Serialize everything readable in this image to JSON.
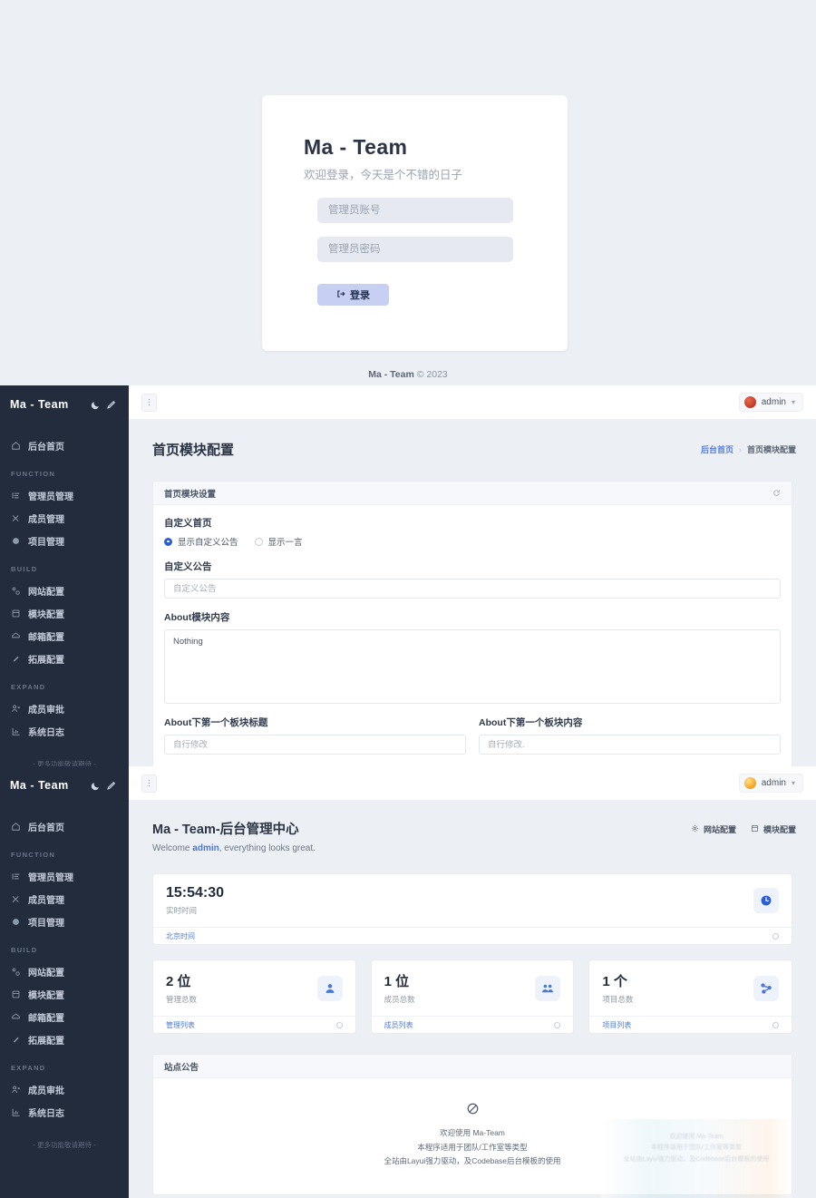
{
  "login": {
    "title": "Ma - Team",
    "subtitle": "欢迎登录，今天是个不错的日子",
    "username_placeholder": "管理员账号",
    "username_value": "",
    "password_placeholder": "管理员密码",
    "password_value": "",
    "submit_label": "登录",
    "footer": "Ma - Team © 2023",
    "footer_brand": "Ma - Team",
    "footer_rest": " © 2023",
    "button_color": "#c7d0f2",
    "background": "#eceff4"
  },
  "sidebar": {
    "logo": "Ma - Team",
    "theme_icon": "moon-icon",
    "edit_icon": "pen-icon",
    "footer_note": "- 更多功能敬请期待 -",
    "groups": [
      {
        "label": "",
        "items": [
          {
            "label": "后台首页",
            "icon": "home-icon"
          }
        ]
      },
      {
        "label": "FUNCTION",
        "items": [
          {
            "label": "管理员管理",
            "icon": "list-icon"
          },
          {
            "label": "成员管理",
            "icon": "shuffle-icon"
          },
          {
            "label": "项目管理",
            "icon": "box-icon"
          }
        ]
      },
      {
        "label": "BUILD",
        "items": [
          {
            "label": "网站配置",
            "icon": "settings-icon"
          },
          {
            "label": "模块配置",
            "icon": "module-icon"
          },
          {
            "label": "邮箱配置",
            "icon": "mail-icon"
          },
          {
            "label": "拓展配置",
            "icon": "plugin-icon"
          }
        ]
      },
      {
        "label": "EXPAND",
        "items": [
          {
            "label": "成员审批",
            "icon": "user-check-icon"
          },
          {
            "label": "系统日志",
            "icon": "chart-icon"
          }
        ]
      }
    ]
  },
  "panel_one": {
    "topbar": {
      "menu_icon": "dots-vertical-icon",
      "user": "admin",
      "avatar": "red-avatar",
      "chevron": "chevron-down-icon"
    },
    "page_title": "首页模块配置",
    "breadcrumb": {
      "home": "后台首页",
      "sep": "›",
      "current": "首页模块配置"
    },
    "card": {
      "title": "首页模块设置",
      "refresh_icon": "refresh-icon",
      "section_label": "自定义首页",
      "radios": [
        {
          "label": "显示自定义公告",
          "selected": true
        },
        {
          "label": "显示一言",
          "selected": false
        }
      ],
      "notice_label": "自定义公告",
      "notice_placeholder": "自定义公告",
      "notice_value": "",
      "about_label": "About模块内容",
      "about_value": "Nothing",
      "sub_title_label": "About下第一个板块标题",
      "sub_title_placeholder": "自行修改",
      "sub_title_value": "",
      "sub_content_label": "About下第一个板块内容",
      "sub_content_placeholder": "自行修改.",
      "sub_content_value": ""
    }
  },
  "panel_two": {
    "topbar": {
      "menu_icon": "dots-vertical-icon",
      "user": "admin",
      "avatar": "yellow-avatar",
      "chevron": "chevron-down-icon"
    },
    "title": "Ma - Team-后台管理中心",
    "welcome_prefix": "Welcome ",
    "welcome_user": "admin",
    "welcome_suffix": ", everything looks great.",
    "actions": [
      {
        "label": "网站配置",
        "icon": "gear-icon"
      },
      {
        "label": "模块配置",
        "icon": "module-icon"
      }
    ],
    "time_card": {
      "value": "15:54:30",
      "caption": "实时时间",
      "footer_link": "北京时间",
      "icon": "clock-icon"
    },
    "stats": [
      {
        "value": "2 位",
        "caption": "管理总数",
        "link": "管理列表",
        "icon": "user-icon"
      },
      {
        "value": "1 位",
        "caption": "成员总数",
        "link": "成员列表",
        "icon": "users-icon"
      },
      {
        "value": "1 个",
        "caption": "项目总数",
        "link": "项目列表",
        "icon": "sitemap-icon"
      }
    ],
    "notice": {
      "title": "站点公告",
      "icon": "ban-icon",
      "lines": [
        "欢迎使用 Ma-Team",
        "本程序适用于团队/工作室等类型",
        "全站由Layui强力驱动，及Codebase后台模板的使用"
      ]
    }
  }
}
